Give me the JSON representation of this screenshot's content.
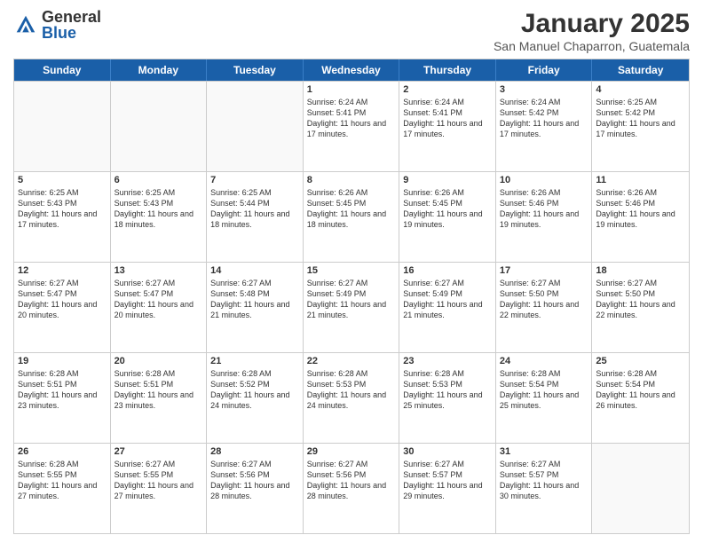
{
  "logo": {
    "general": "General",
    "blue": "Blue"
  },
  "title": "January 2025",
  "subtitle": "San Manuel Chaparron, Guatemala",
  "days": [
    "Sunday",
    "Monday",
    "Tuesday",
    "Wednesday",
    "Thursday",
    "Friday",
    "Saturday"
  ],
  "weeks": [
    [
      {
        "day": "",
        "info": ""
      },
      {
        "day": "",
        "info": ""
      },
      {
        "day": "",
        "info": ""
      },
      {
        "day": "1",
        "info": "Sunrise: 6:24 AM\nSunset: 5:41 PM\nDaylight: 11 hours and 17 minutes."
      },
      {
        "day": "2",
        "info": "Sunrise: 6:24 AM\nSunset: 5:41 PM\nDaylight: 11 hours and 17 minutes."
      },
      {
        "day": "3",
        "info": "Sunrise: 6:24 AM\nSunset: 5:42 PM\nDaylight: 11 hours and 17 minutes."
      },
      {
        "day": "4",
        "info": "Sunrise: 6:25 AM\nSunset: 5:42 PM\nDaylight: 11 hours and 17 minutes."
      }
    ],
    [
      {
        "day": "5",
        "info": "Sunrise: 6:25 AM\nSunset: 5:43 PM\nDaylight: 11 hours and 17 minutes."
      },
      {
        "day": "6",
        "info": "Sunrise: 6:25 AM\nSunset: 5:43 PM\nDaylight: 11 hours and 18 minutes."
      },
      {
        "day": "7",
        "info": "Sunrise: 6:25 AM\nSunset: 5:44 PM\nDaylight: 11 hours and 18 minutes."
      },
      {
        "day": "8",
        "info": "Sunrise: 6:26 AM\nSunset: 5:45 PM\nDaylight: 11 hours and 18 minutes."
      },
      {
        "day": "9",
        "info": "Sunrise: 6:26 AM\nSunset: 5:45 PM\nDaylight: 11 hours and 19 minutes."
      },
      {
        "day": "10",
        "info": "Sunrise: 6:26 AM\nSunset: 5:46 PM\nDaylight: 11 hours and 19 minutes."
      },
      {
        "day": "11",
        "info": "Sunrise: 6:26 AM\nSunset: 5:46 PM\nDaylight: 11 hours and 19 minutes."
      }
    ],
    [
      {
        "day": "12",
        "info": "Sunrise: 6:27 AM\nSunset: 5:47 PM\nDaylight: 11 hours and 20 minutes."
      },
      {
        "day": "13",
        "info": "Sunrise: 6:27 AM\nSunset: 5:47 PM\nDaylight: 11 hours and 20 minutes."
      },
      {
        "day": "14",
        "info": "Sunrise: 6:27 AM\nSunset: 5:48 PM\nDaylight: 11 hours and 21 minutes."
      },
      {
        "day": "15",
        "info": "Sunrise: 6:27 AM\nSunset: 5:49 PM\nDaylight: 11 hours and 21 minutes."
      },
      {
        "day": "16",
        "info": "Sunrise: 6:27 AM\nSunset: 5:49 PM\nDaylight: 11 hours and 21 minutes."
      },
      {
        "day": "17",
        "info": "Sunrise: 6:27 AM\nSunset: 5:50 PM\nDaylight: 11 hours and 22 minutes."
      },
      {
        "day": "18",
        "info": "Sunrise: 6:27 AM\nSunset: 5:50 PM\nDaylight: 11 hours and 22 minutes."
      }
    ],
    [
      {
        "day": "19",
        "info": "Sunrise: 6:28 AM\nSunset: 5:51 PM\nDaylight: 11 hours and 23 minutes."
      },
      {
        "day": "20",
        "info": "Sunrise: 6:28 AM\nSunset: 5:51 PM\nDaylight: 11 hours and 23 minutes."
      },
      {
        "day": "21",
        "info": "Sunrise: 6:28 AM\nSunset: 5:52 PM\nDaylight: 11 hours and 24 minutes."
      },
      {
        "day": "22",
        "info": "Sunrise: 6:28 AM\nSunset: 5:53 PM\nDaylight: 11 hours and 24 minutes."
      },
      {
        "day": "23",
        "info": "Sunrise: 6:28 AM\nSunset: 5:53 PM\nDaylight: 11 hours and 25 minutes."
      },
      {
        "day": "24",
        "info": "Sunrise: 6:28 AM\nSunset: 5:54 PM\nDaylight: 11 hours and 25 minutes."
      },
      {
        "day": "25",
        "info": "Sunrise: 6:28 AM\nSunset: 5:54 PM\nDaylight: 11 hours and 26 minutes."
      }
    ],
    [
      {
        "day": "26",
        "info": "Sunrise: 6:28 AM\nSunset: 5:55 PM\nDaylight: 11 hours and 27 minutes."
      },
      {
        "day": "27",
        "info": "Sunrise: 6:27 AM\nSunset: 5:55 PM\nDaylight: 11 hours and 27 minutes."
      },
      {
        "day": "28",
        "info": "Sunrise: 6:27 AM\nSunset: 5:56 PM\nDaylight: 11 hours and 28 minutes."
      },
      {
        "day": "29",
        "info": "Sunrise: 6:27 AM\nSunset: 5:56 PM\nDaylight: 11 hours and 28 minutes."
      },
      {
        "day": "30",
        "info": "Sunrise: 6:27 AM\nSunset: 5:57 PM\nDaylight: 11 hours and 29 minutes."
      },
      {
        "day": "31",
        "info": "Sunrise: 6:27 AM\nSunset: 5:57 PM\nDaylight: 11 hours and 30 minutes."
      },
      {
        "day": "",
        "info": ""
      }
    ]
  ]
}
